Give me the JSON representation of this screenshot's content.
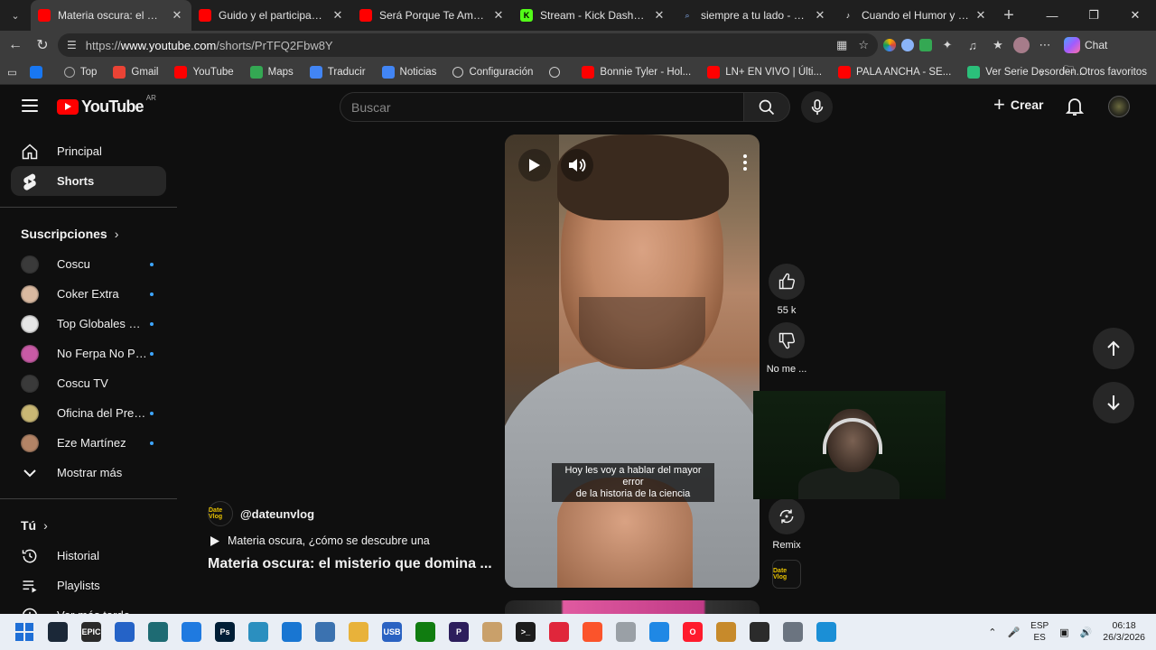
{
  "browser": {
    "tabs": [
      {
        "title": "Materia oscura: el misterio qu",
        "active": true,
        "favicon": "youtube-icon",
        "color": "#ff0000"
      },
      {
        "title": "Guido y el participante que e",
        "active": false,
        "favicon": "youtube-icon",
        "color": "#ff0000"
      },
      {
        "title": "Será Porque Te Amo - YouTu",
        "active": false,
        "favicon": "youtube-icon",
        "color": "#ff0000"
      },
      {
        "title": "Stream - Kick Dashboard",
        "active": false,
        "favicon": "kick-icon",
        "color": "#53fc18"
      },
      {
        "title": "siempre a tu lado - Búsqueda",
        "active": false,
        "favicon": "search-icon",
        "color": "#8ab4f8"
      },
      {
        "title": "Cuando el Humor y las Mater",
        "active": false,
        "favicon": "tiktok-icon",
        "color": "#ffffff"
      }
    ],
    "url_prefix": "https://",
    "url_host": "www.youtube.com",
    "url_path": "/shorts/PrTFQ2Fbw8Y",
    "chat_label": "Chat",
    "bookmarks": [
      {
        "label": "",
        "icon": "facebook-icon",
        "color": "#1877f2"
      },
      {
        "label": "Top",
        "icon": "globe-icon",
        "color": "#aaaaaa"
      },
      {
        "label": "Gmail",
        "icon": "gmail-icon",
        "color": "#ea4335"
      },
      {
        "label": "YouTube",
        "icon": "youtube-icon",
        "color": "#ff0000"
      },
      {
        "label": "Maps",
        "icon": "maps-icon",
        "color": "#34a853"
      },
      {
        "label": "Traducir",
        "icon": "translate-icon",
        "color": "#4285f4"
      },
      {
        "label": "Noticias",
        "icon": "news-icon",
        "color": "#4285f4"
      },
      {
        "label": "Configuración",
        "icon": "gear-icon",
        "color": "#cccccc"
      },
      {
        "label": "",
        "icon": "globe-icon",
        "color": "#cccccc"
      },
      {
        "label": "Bonnie Tyler - Hol...",
        "icon": "youtube-icon",
        "color": "#ff0000"
      },
      {
        "label": "LN+ EN VIVO | Últi...",
        "icon": "youtube-icon",
        "color": "#ff0000"
      },
      {
        "label": "PALA ANCHA - SE...",
        "icon": "youtube-icon",
        "color": "#ff0000"
      },
      {
        "label": "Ver Serie Desorden...",
        "icon": "c-icon",
        "color": "#2bbf7a"
      }
    ],
    "other_favorites": "Otros favoritos"
  },
  "youtube": {
    "logo_text": "YouTube",
    "region": "AR",
    "search_placeholder": "Buscar",
    "create_label": "Crear",
    "sidebar": {
      "main": [
        {
          "label": "Principal",
          "icon": "home-icon",
          "active": false
        },
        {
          "label": "Shorts",
          "icon": "shorts-icon",
          "active": true
        }
      ],
      "subscriptions_heading": "Suscripciones",
      "subscriptions": [
        {
          "label": "Coscu",
          "avatar_color": "#3a3a3a",
          "new": true
        },
        {
          "label": "Coker Extra",
          "avatar_color": "#d9b9a0",
          "new": true
        },
        {
          "label": "Top Globales Ext...",
          "avatar_color": "#e6e6e6",
          "new": true
        },
        {
          "label": "No Ferpa No Party",
          "avatar_color": "#c85aa5",
          "new": true
        },
        {
          "label": "Coscu TV",
          "avatar_color": "#3a3a3a",
          "new": false
        },
        {
          "label": "Oficina del Presi...",
          "avatar_color": "#c9b774",
          "new": true
        },
        {
          "label": "Eze Martínez",
          "avatar_color": "#b38466",
          "new": true
        }
      ],
      "show_more": "Mostrar más",
      "you_heading": "Tú",
      "you_items": [
        {
          "label": "Historial",
          "icon": "history-icon"
        },
        {
          "label": "Playlists",
          "icon": "playlists-icon"
        },
        {
          "label": "Ver más tarde",
          "icon": "watch-later-icon"
        }
      ]
    },
    "short": {
      "caption_line1": "Hoy les voy a hablar del mayor error",
      "caption_line2": "de la historia de la ciencia",
      "channel": "@dateunvlog",
      "channel_avatar_text": "Date Vlog",
      "sound": "Materia oscura, ¿cómo se descubre una",
      "title": "Materia oscura: el misterio que domina ...",
      "likes": "55 k",
      "dislike_label": "No me ...",
      "remix_label": "Remix"
    }
  },
  "taskbar": {
    "apps": [
      {
        "name": "windows-start-icon",
        "color": "#1f6fd6",
        "text": ""
      },
      {
        "name": "steam-icon",
        "color": "#1b2838",
        "text": ""
      },
      {
        "name": "epic-games-icon",
        "color": "#2a2a2a",
        "text": "EPIC"
      },
      {
        "name": "store-icon",
        "color": "#2563c7",
        "text": ""
      },
      {
        "name": "app-icon",
        "color": "#1e6b73",
        "text": ""
      },
      {
        "name": "defender-icon",
        "color": "#1f7ae0",
        "text": ""
      },
      {
        "name": "photoshop-icon",
        "color": "#001e36",
        "text": "Ps"
      },
      {
        "name": "network-icon",
        "color": "#2b8fbf",
        "text": ""
      },
      {
        "name": "camera-icon",
        "color": "#1976d2",
        "text": ""
      },
      {
        "name": "python-icon",
        "color": "#3b72b0",
        "text": ""
      },
      {
        "name": "folder-icon",
        "color": "#e8b23a",
        "text": ""
      },
      {
        "name": "usb-util-icon",
        "color": "#2a62c2",
        "text": "USB"
      },
      {
        "name": "xbox-icon",
        "color": "#107c10",
        "text": ""
      },
      {
        "name": "premiere-icon",
        "color": "#2d1e5c",
        "text": "P"
      },
      {
        "name": "tool-icon",
        "color": "#c9a06a",
        "text": ""
      },
      {
        "name": "terminal-icon",
        "color": "#1c1c1c",
        "text": ">_"
      },
      {
        "name": "opera-gx-icon",
        "color": "#e0263b",
        "text": ""
      },
      {
        "name": "brave-icon",
        "color": "#fb542b",
        "text": ""
      },
      {
        "name": "discord-icon",
        "color": "#9aa0a6",
        "text": ""
      },
      {
        "name": "vscode-icon",
        "color": "#1f88e5",
        "text": ""
      },
      {
        "name": "opera-icon",
        "color": "#ff1b2d",
        "text": "O"
      },
      {
        "name": "game-icon",
        "color": "#c78a2b",
        "text": ""
      },
      {
        "name": "obs-icon",
        "color": "#2b2b2b",
        "text": ""
      },
      {
        "name": "settings-icon",
        "color": "#6b7480",
        "text": ""
      },
      {
        "name": "edge-icon",
        "color": "#1b8fd6",
        "text": ""
      }
    ],
    "lang_top": "ESP",
    "lang_bottom": "ES",
    "time": "06:18",
    "date": "26/3/2026"
  }
}
